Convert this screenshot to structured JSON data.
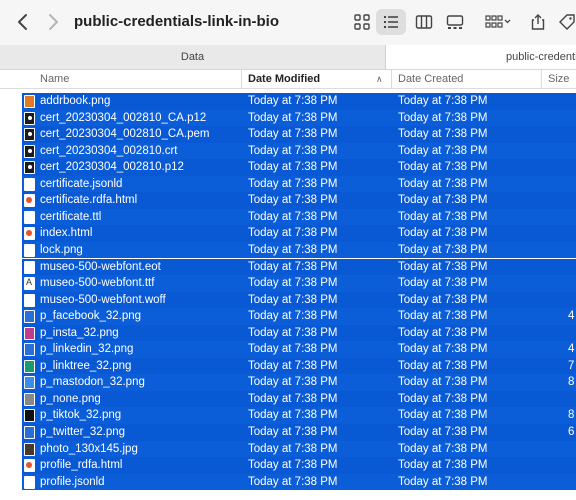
{
  "window": {
    "title": "public-credentials-link-in-bio"
  },
  "tabs": [
    {
      "label": "Data"
    },
    {
      "label": "public-credentials"
    }
  ],
  "columns": {
    "name": "Name",
    "date_modified": "Date Modified",
    "date_created": "Date Created",
    "size": "Size"
  },
  "colors": {
    "selection": "#0a59d4",
    "toolbar": "#f6f6f6"
  },
  "rows": [
    {
      "name": "addrbook.png",
      "modified": "Today at 7:38 PM",
      "created": "Today at 7:38 PM",
      "size": "",
      "icon": "image-orange-icon"
    },
    {
      "name": "cert_20230304_002810_CA.p12",
      "modified": "Today at 7:38 PM",
      "created": "Today at 7:38 PM",
      "size": "",
      "icon": "certificate-icon"
    },
    {
      "name": "cert_20230304_002810_CA.pem",
      "modified": "Today at 7:38 PM",
      "created": "Today at 7:38 PM",
      "size": "",
      "icon": "certificate-icon"
    },
    {
      "name": "cert_20230304_002810.crt",
      "modified": "Today at 7:38 PM",
      "created": "Today at 7:38 PM",
      "size": "",
      "icon": "certificate-icon"
    },
    {
      "name": "cert_20230304_002810.p12",
      "modified": "Today at 7:38 PM",
      "created": "Today at 7:38 PM",
      "size": "",
      "icon": "certificate-icon"
    },
    {
      "name": "certificate.jsonld",
      "modified": "Today at 7:38 PM",
      "created": "Today at 7:38 PM",
      "size": "",
      "icon": "document-icon"
    },
    {
      "name": "certificate.rdfa.html",
      "modified": "Today at 7:38 PM",
      "created": "Today at 7:38 PM",
      "size": "",
      "icon": "html-icon"
    },
    {
      "name": "certificate.ttl",
      "modified": "Today at 7:38 PM",
      "created": "Today at 7:38 PM",
      "size": "",
      "icon": "document-icon"
    },
    {
      "name": "index.html",
      "modified": "Today at 7:38 PM",
      "created": "Today at 7:38 PM",
      "size": "",
      "icon": "html-icon"
    },
    {
      "name": "lock.png",
      "modified": "Today at 7:38 PM",
      "created": "Today at 7:38 PM",
      "size": "",
      "icon": "document-icon"
    },
    {
      "name": "museo-500-webfont.eot",
      "modified": "Today at 7:38 PM",
      "created": "Today at 7:38 PM",
      "size": "",
      "icon": "document-icon"
    },
    {
      "name": "museo-500-webfont.ttf",
      "modified": "Today at 7:38 PM",
      "created": "Today at 7:38 PM",
      "size": "",
      "icon": "font-icon"
    },
    {
      "name": "museo-500-webfont.woff",
      "modified": "Today at 7:38 PM",
      "created": "Today at 7:38 PM",
      "size": "",
      "icon": "document-icon"
    },
    {
      "name": "p_facebook_32.png",
      "modified": "Today at 7:38 PM",
      "created": "Today at 7:38 PM",
      "size": "4",
      "icon": "facebook-icon"
    },
    {
      "name": "p_insta_32.png",
      "modified": "Today at 7:38 PM",
      "created": "Today at 7:38 PM",
      "size": "",
      "icon": "instagram-icon"
    },
    {
      "name": "p_linkedin_32.png",
      "modified": "Today at 7:38 PM",
      "created": "Today at 7:38 PM",
      "size": "4",
      "icon": "linkedin-icon"
    },
    {
      "name": "p_linktree_32.png",
      "modified": "Today at 7:38 PM",
      "created": "Today at 7:38 PM",
      "size": "7",
      "icon": "linktree-icon"
    },
    {
      "name": "p_mastodon_32.png",
      "modified": "Today at 7:38 PM",
      "created": "Today at 7:38 PM",
      "size": "8",
      "icon": "mastodon-icon"
    },
    {
      "name": "p_none.png",
      "modified": "Today at 7:38 PM",
      "created": "Today at 7:38 PM",
      "size": "",
      "icon": "image-gray-icon"
    },
    {
      "name": "p_tiktok_32.png",
      "modified": "Today at 7:38 PM",
      "created": "Today at 7:38 PM",
      "size": "8",
      "icon": "tiktok-icon"
    },
    {
      "name": "p_twitter_32.png",
      "modified": "Today at 7:38 PM",
      "created": "Today at 7:38 PM",
      "size": "6",
      "icon": "twitter-icon"
    },
    {
      "name": "photo_130x145.jpg",
      "modified": "Today at 7:38 PM",
      "created": "Today at 7:38 PM",
      "size": "",
      "icon": "photo-icon"
    },
    {
      "name": "profile_rdfa.html",
      "modified": "Today at 7:38 PM",
      "created": "Today at 7:38 PM",
      "size": "",
      "icon": "html-icon"
    },
    {
      "name": "profile.jsonld",
      "modified": "Today at 7:38 PM",
      "created": "Today at 7:38 PM",
      "size": "",
      "icon": "document-icon"
    }
  ]
}
